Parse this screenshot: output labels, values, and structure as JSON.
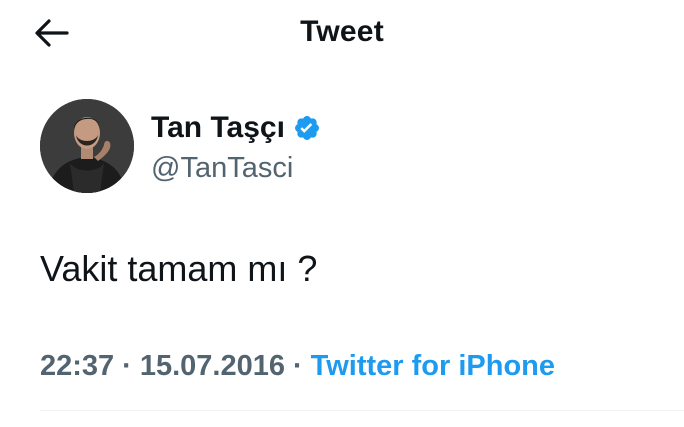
{
  "header": {
    "back_icon": "arrow-left-icon",
    "title": "Tweet"
  },
  "author": {
    "name": "Tan Taşçı",
    "handle": "@TanTasci",
    "verified": true,
    "verified_icon": "verified-badge-icon",
    "verified_color": "#1d9bf0"
  },
  "tweet": {
    "text": "Vakit tamam mı ?",
    "time": "22:37",
    "separator": "·",
    "date": "15.07.2016",
    "source": "Twitter for iPhone"
  },
  "colors": {
    "text_primary": "#0f1419",
    "text_secondary": "#536471",
    "accent": "#1d9bf0",
    "divider": "#eff3f4"
  }
}
